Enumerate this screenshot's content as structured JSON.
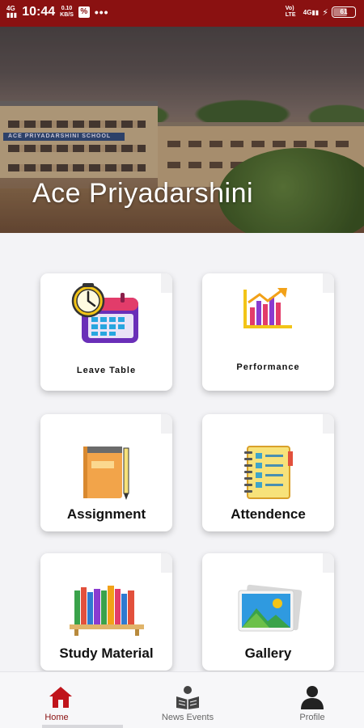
{
  "status_bar": {
    "network": "4G",
    "time": "10:44",
    "speed_value": "0.10",
    "speed_unit": "KB/S",
    "app_badge": "%",
    "more": "•••",
    "volte": "Vo) LTE",
    "signal": "4G",
    "battery": "61"
  },
  "hero": {
    "title": "Ace Priyadarshini",
    "sign_text": "ACE PRIYADARSHINI SCHOOL"
  },
  "menu": [
    {
      "label": "Leave Table",
      "icon": "calendar-clock-icon"
    },
    {
      "label": "Performance",
      "icon": "bar-chart-icon"
    },
    {
      "label": "Assignment",
      "icon": "notebook-pencil-icon"
    },
    {
      "label": "Attendence",
      "icon": "checklist-notebook-icon"
    },
    {
      "label": "Study Material",
      "icon": "bookshelf-icon"
    },
    {
      "label": "Gallery",
      "icon": "photo-gallery-icon"
    }
  ],
  "bottom_nav": {
    "home": "Home",
    "news_events": "News Events",
    "profile": "Profile"
  },
  "colors": {
    "status_bar": "#8a1111",
    "active_nav": "#c0141b"
  }
}
